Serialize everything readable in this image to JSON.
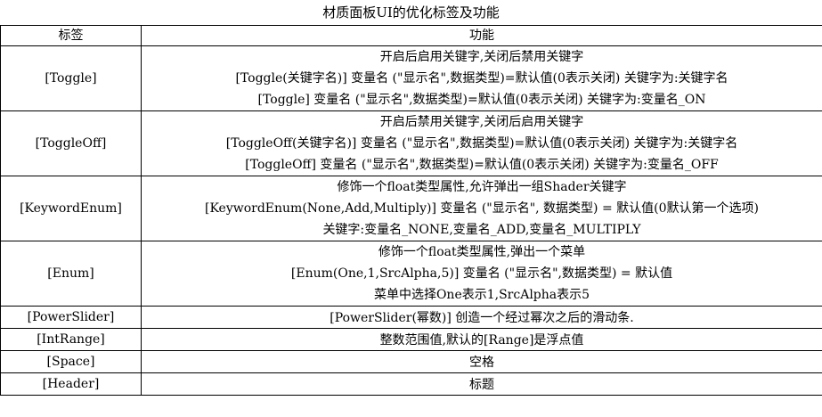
{
  "title": "材质面板UI的优化标签及功能",
  "columns": {
    "tag": "标签",
    "function": "功能"
  },
  "rows": [
    {
      "tag": "[Toggle]",
      "lines": [
        "开启后启用关键字,关闭后禁用关键字",
        "[Toggle(关键字名)] 变量名 (\"显示名\",数据类型)=默认值(0表示关闭)  关键字为:关键字名",
        "[Toggle] 变量名 (\"显示名\",数据类型)=默认值(0表示关闭)  关键字为:变量名_ON"
      ]
    },
    {
      "tag": "[ToggleOff]",
      "lines": [
        "开启后禁用关键字,关闭后启用关键字",
        "[ToggleOff(关键字名)] 变量名 (\"显示名\",数据类型)=默认值(0表示关闭)  关键字为:关键字名",
        "[ToggleOff] 变量名 (\"显示名\",数据类型)=默认值(0表示关闭)  关键字为:变量名_OFF"
      ]
    },
    {
      "tag": "[KeywordEnum]",
      "lines": [
        "修饰一个float类型属性,允许弹出一组Shader关键字",
        "[KeywordEnum(None,Add,Multiply)] 变量名 (\"显示名\", 数据类型) = 默认值(0默认第一个选项)",
        "关键字:变量名_NONE,变量名_ADD,变量名_MULTIPLY"
      ]
    },
    {
      "tag": "[Enum]",
      "lines": [
        "修饰一个float类型属性,弹出一个菜单",
        "[Enum(One,1,SrcAlpha,5)] 变量名 (\"显示名\",数据类型) = 默认值",
        "菜单中选择One表示1,SrcAlpha表示5"
      ]
    },
    {
      "tag": "[PowerSlider]",
      "lines": [
        "[PowerSlider(幂数)]  创造一个经过幂次之后的滑动条."
      ]
    },
    {
      "tag": "[IntRange]",
      "lines": [
        "整数范围值,默认的[Range]是浮点值"
      ]
    },
    {
      "tag": "[Space]",
      "lines": [
        "空格"
      ]
    },
    {
      "tag": "[Header]",
      "lines": [
        "标题"
      ]
    }
  ]
}
